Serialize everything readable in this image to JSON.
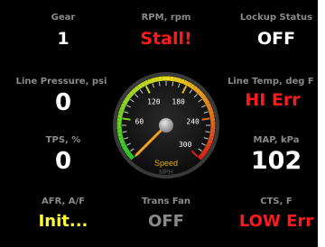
{
  "dashboard": {
    "gear": {
      "label": "Gear",
      "value": "1"
    },
    "rpm": {
      "label": "RPM, rpm",
      "value": "Stall!"
    },
    "lockup": {
      "label": "Lockup Status",
      "value": "OFF"
    },
    "line_pressure": {
      "label": "Line Pressure, psi",
      "value": "0"
    },
    "line_temp": {
      "label": "Line Temp, deg F",
      "value": "HI Err"
    },
    "tps": {
      "label": "TPS, %",
      "value": "0"
    },
    "map": {
      "label": "MAP, kPa",
      "value": "102"
    },
    "afr": {
      "label": "AFR, A/F",
      "value": "Init..."
    },
    "trans_fan": {
      "label": "Trans Fan",
      "value": "OFF"
    },
    "cts": {
      "label": "CTS, F",
      "value": "LOW Err"
    }
  },
  "speedometer": {
    "title": "Speed",
    "unit": "MPH",
    "tick_labels": [
      "60",
      "120",
      "180",
      "240",
      "300"
    ],
    "scale": [
      0,
      300
    ],
    "needle_value": 0
  },
  "colors": {
    "label": "#8a8a8a",
    "value_normal": "#ffffff",
    "value_error": "#ff1a1a",
    "value_warning": "#ffff33"
  }
}
